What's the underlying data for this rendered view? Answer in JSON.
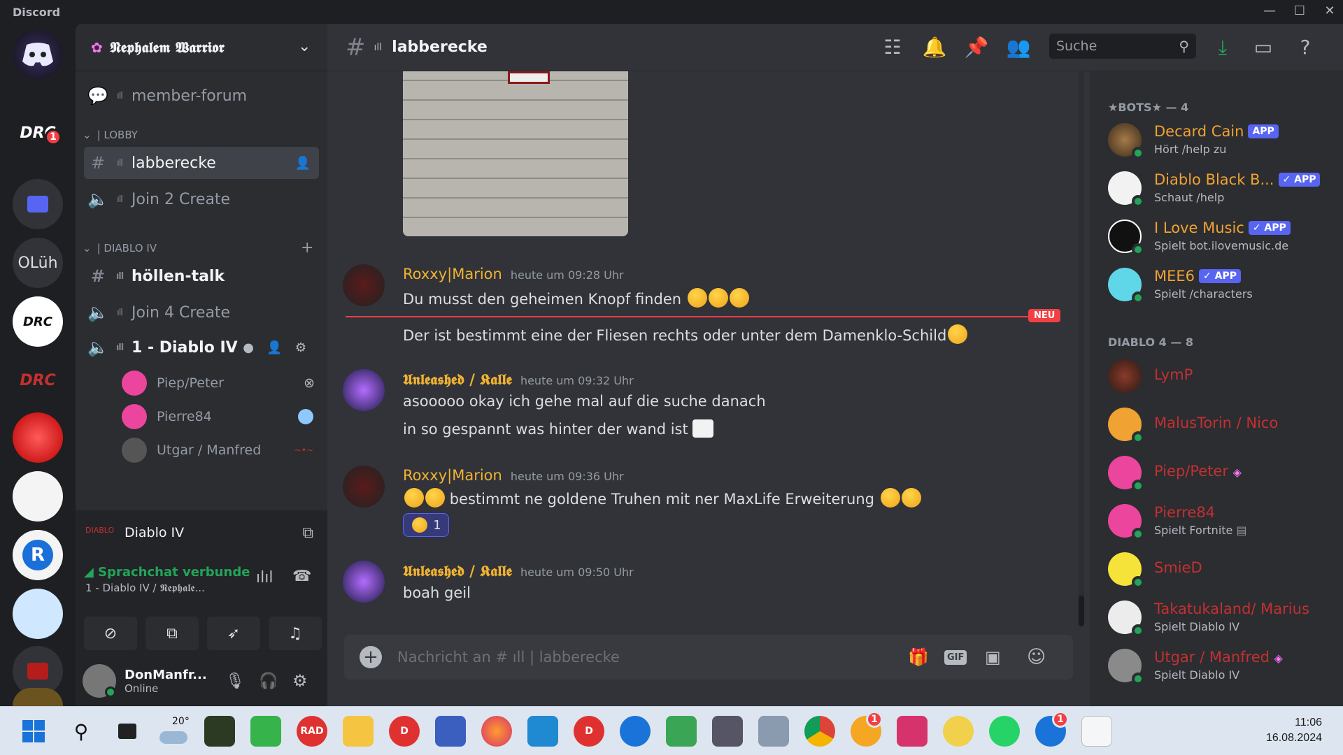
{
  "app": {
    "title": "Discord"
  },
  "window_controls": {
    "minimize": "—",
    "maximize": "☐",
    "close": "✕"
  },
  "rail": {
    "server_badges": [
      "1"
    ],
    "olueh_label": "OLüh"
  },
  "guild": {
    "name": "𝕹𝖊𝖕𝖍𝖆𝖑𝖊𝖒 𝖂𝖆𝖗𝖗𝖎𝖔𝖗"
  },
  "sidebar": {
    "forum": {
      "label": "member-forum"
    },
    "cat_lobby": "| LOBBY",
    "lobby_channels": [
      {
        "label": "labberecke"
      },
      {
        "label": "Join 2 Create"
      }
    ],
    "cat_diablo": "| DIABLO IV",
    "diablo_channels": [
      {
        "label": "höllen-talk"
      },
      {
        "label": "Join 4 Create"
      },
      {
        "label": "1 - Diablo IV"
      }
    ],
    "voice_users": [
      {
        "name": "Piep/Peter"
      },
      {
        "name": "Pierre84"
      },
      {
        "name": "Utgar / Manfred"
      }
    ]
  },
  "game_panel": {
    "title": "Diablo IV"
  },
  "voice_panel": {
    "status": "Sprachchat verbunde",
    "channel": "1 - Diablo IV / 𝕹𝖊𝖕𝖍𝖆𝖑𝖊..."
  },
  "user_panel": {
    "name": "DonManfr...",
    "status": "Online"
  },
  "header": {
    "channel": "labberecke",
    "search_placeholder": "Suche"
  },
  "messages": [
    {
      "author": "Roxxy|Marion",
      "time": "heute um 09:28 Uhr",
      "lines": [
        "Du musst den geheimen Knopf finden"
      ]
    },
    {
      "divider": "NEU",
      "lines": [
        "Der ist bestimmt eine der Fliesen rechts oder unter dem Damenklo-Schild"
      ]
    },
    {
      "author": "𝖀𝖓𝖑𝖊𝖆𝖘𝖍𝖊𝖉 / 𝕶𝖆𝖑𝖑𝖊",
      "time": "heute um 09:32 Uhr",
      "lines": [
        "asooooo okay ich gehe mal auf die suche danach",
        "in so gespannt was hinter der wand ist"
      ]
    },
    {
      "author": "Roxxy|Marion",
      "time": "heute um 09:36 Uhr",
      "lines": [
        "bestimmt ne goldene Truhen mit ner MaxLife Erweiterung"
      ],
      "reaction_count": "1"
    },
    {
      "author": "𝖀𝖓𝖑𝖊𝖆𝖘𝖍𝖊𝖉 / 𝕶𝖆𝖑𝖑𝖊",
      "time": "heute um 09:50 Uhr",
      "lines": [
        "boah geil"
      ]
    }
  ],
  "composer": {
    "placeholder": "Nachricht an # ıll | labberecke"
  },
  "members": {
    "groups": [
      {
        "title": "★BOTS★ — 4",
        "items": [
          {
            "name": "Decard Cain",
            "status": "Hört /help zu",
            "badge": "APP"
          },
          {
            "name": "Diablo Black B...",
            "status": "Schaut /help",
            "badge": "✓ APP"
          },
          {
            "name": "I Love Music",
            "status": "Spielt bot.ilovemusic.de",
            "badge": "✓ APP"
          },
          {
            "name": "MEE6",
            "status": "Spielt /characters",
            "badge": "✓ APP"
          }
        ]
      },
      {
        "title": "DIABLO 4 — 8",
        "items": [
          {
            "name": "LymP",
            "status": ""
          },
          {
            "name": "MalusTorin / Nico",
            "status": ""
          },
          {
            "name": "Piep/Peter",
            "status": ""
          },
          {
            "name": "Pierre84",
            "status": "Spielt Fortnite"
          },
          {
            "name": "SmieD",
            "status": ""
          },
          {
            "name": "Takatukaland/ Marius",
            "status": "Spielt Diablo IV"
          },
          {
            "name": "Utgar / Manfred",
            "status": "Spielt Diablo IV"
          }
        ]
      }
    ]
  },
  "taskbar": {
    "weather": "20°",
    "time": "11:06",
    "date": "16.08.2024",
    "rad_label": "RAD",
    "badges": [
      "1",
      "1"
    ]
  },
  "colors": {
    "accent": "#5865f2",
    "online": "#23a559",
    "role_gold": "#f0b232",
    "role_red": "#c43030",
    "new_red": "#f23f43"
  }
}
